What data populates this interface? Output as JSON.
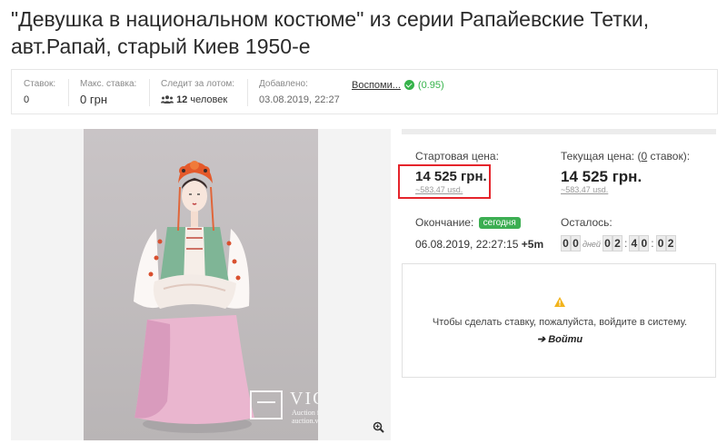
{
  "lot": {
    "title": "\"Девушка в национальном костюме\" из серии Рапайевские Тетки, авт.Рапай, старый Киев 1950-е"
  },
  "stats": {
    "bids_label": "Ставок:",
    "bids_value": "0",
    "max_bid_label": "Макс. ставка:",
    "max_bid_value": "0 грн",
    "watchers_label": "Следит за лотом:",
    "watchers_count": "12",
    "watchers_unit": "человек",
    "added_label": "Добавлено:",
    "added_value": "03.08.2019, 22:27",
    "seller_name": "Воспоми...",
    "seller_rating": "(0.95)"
  },
  "watermark": {
    "brand": "VIOLITY",
    "tagline": "Auction for Collectors",
    "url": "auction.violity.com"
  },
  "price": {
    "start_label": "Стартовая цена:",
    "start_value": "14 525  грн.",
    "start_usd": "~583.47  usd.",
    "current_label_prefix": "Текущая цена: (",
    "current_bids": "0",
    "current_label_suffix": " ставок):",
    "current_value": "14 525  грн.",
    "current_usd": "~583.47  usd."
  },
  "ending": {
    "label": "Окончание:",
    "badge": "сегодня",
    "datetime": "06.08.2019, 22:27:15",
    "timezone": "+5m",
    "remaining_label": "Осталось:",
    "days_digits": [
      "0",
      "0"
    ],
    "days_word": "дней",
    "hours_digits": [
      "0",
      "2"
    ],
    "minutes_digits": [
      "4",
      "0"
    ],
    "seconds_digits": [
      "0",
      "2"
    ],
    "separator": ":"
  },
  "login": {
    "message": "Чтобы сделать ставку, пожалуйста, войдите в систему.",
    "link": "➔ Войти"
  },
  "colors": {
    "accent_green": "#3cae52",
    "highlight_red": "#e5242b"
  }
}
